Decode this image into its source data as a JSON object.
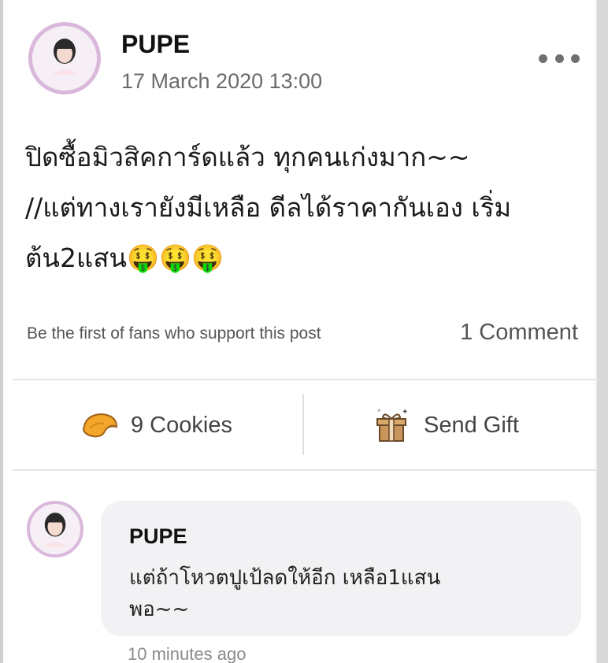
{
  "post": {
    "author": "PUPE",
    "timestamp": "17 March 2020 13:00",
    "body": "ปิดซื้อมิวสิคการ์ดแล้ว ทุกคนเก่งมาก~~\n//แต่ทางเรายังมีเหลือ ดีลได้ราคากันเอง เริ่ม\nต้น2แสน🤑🤑🤑"
  },
  "engagement": {
    "support_text": "Be the first of fans who support this post",
    "comment_count": "1 Comment"
  },
  "actions": {
    "cookies_label": "9 Cookies",
    "gift_label": "Send Gift"
  },
  "comment": {
    "author": "PUPE",
    "text": "แต่ถ้าโหวตปูเป้ลดให้อีก เหลือ1แสน\nพอ~~",
    "time": "10 minutes ago"
  },
  "colors": {
    "avatar_ring": "#d9b8dc",
    "bubble": "#f2f2f4",
    "divider": "#e6e6e6"
  },
  "icons": [
    "more-icon",
    "fortune-cookie-icon",
    "gift-icon"
  ]
}
